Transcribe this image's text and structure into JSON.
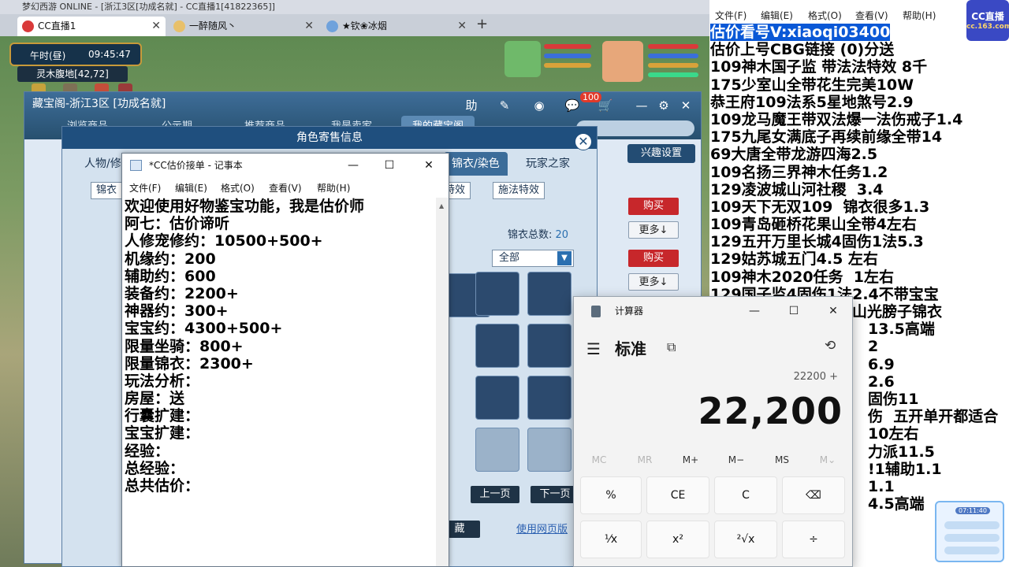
{
  "game_window": {
    "os_title": "梦幻西游 ONLINE - [浙江3区[功成名就] - CC直播1[41822365]]",
    "tabs": [
      {
        "label": "CC直播1",
        "active": true
      },
      {
        "label": "一醉随风丶",
        "active": false
      },
      {
        "label": "★钦❀冰烟",
        "active": false
      }
    ],
    "clock": {
      "period": "午时(昼)",
      "time": "09:45:47"
    },
    "map": "灵木腹地[42,72]"
  },
  "cbg": {
    "title": "藏宝阁-浙江3区 [功成名就]",
    "nav": [
      "浏览商品",
      "公示期",
      "推荐商品",
      "我是卖家",
      "我的藏宝阁"
    ],
    "active_nav": 4,
    "header_buttons": [
      "助",
      "✎",
      "◉",
      "💬",
      "🛒",
      "—",
      "⚙",
      "✕"
    ],
    "badge": "100",
    "interest_button": "兴趣设置",
    "buy_label": "购买",
    "more_label": "更多↓"
  },
  "role_panel": {
    "title": "角色寄售信息",
    "tabs": [
      "人物/修",
      "锦衣/染色",
      "玩家之家"
    ],
    "active_tab": 1,
    "sub_buttons": [
      "锦衣",
      "特效",
      "施法特效"
    ],
    "skin_total_label": "锦衣总数:",
    "skin_total_value": "20",
    "filter_value": "全部",
    "prev_page": "上一页",
    "next_page": "下一页",
    "collect_label": "藏",
    "web_link": "使用网页版"
  },
  "notepad1": {
    "title": "*CC估价接单 - 记事本",
    "menu": [
      "文件(F)",
      "编辑(E)",
      "格式(O)",
      "查看(V)",
      "帮助(H)"
    ],
    "lines": [
      "欢迎使用好物鉴宝功能，我是估价师",
      "阿七：估价谛听",
      "人修宠修约：10500+500+",
      "机缘约：200",
      "辅助约：600",
      "装备约：2200+",
      "神器约：300+",
      "宝宝约：4300+500+",
      "限量坐骑：800+",
      "限量锦衣：2300+",
      "玩法分析：",
      "房屋：送",
      "行囊扩建：",
      "宝宝扩建：",
      "经验：",
      "总经验：",
      "总共估价："
    ]
  },
  "notepad2": {
    "menu": [
      "文件(F)",
      "编辑(E)",
      "格式(O)",
      "查看(V)",
      "帮助(H)"
    ],
    "selected_line": "估价看号V:xiaoqi03400",
    "lines": [
      "估价上号CBG链接 (0)分送",
      "109神木国子监 带法法特效 8千",
      "175少室山全带花生完美10W",
      "恭王府109法系5星地煞号2.9",
      "109龙马魔王带双法爆一法伤戒子1.4",
      "175九尾女满底子再续前缘全带14",
      "69大唐全带龙游四海2.5",
      "109名扬三界神木任务1.2",
      "129凌波城山河社稷  3.4",
      "109天下无双109  锦衣很多1.3",
      "109青岛砸桥花果山全带4左右",
      "129五开万里长城4固伤1法5.3",
      "129姑苏城五门4.5 左右",
      "109神木2020任务  1左右",
      "129国子监4固伤1法2.4不带宝宝",
      "山光膀子锦衣",
      "13.5高端",
      "2",
      "6.9",
      "2.6",
      "固伤11",
      "伤  五开单开都适合",
      "10左右",
      "力派11.5",
      "!1辅助1.1",
      "1.1",
      "4.5高端"
    ],
    "logo": {
      "main": "CC直播",
      "sub": "cc.163.com"
    },
    "widget_time": "07:11:40"
  },
  "calculator": {
    "title": "计算器",
    "mode": "标准",
    "expression": "22200 +",
    "display": "22,200",
    "memory": [
      "MC",
      "MR",
      "M+",
      "M−",
      "MS",
      "M⌄"
    ],
    "keys": [
      "%",
      "CE",
      "C",
      "⌫",
      "¹⁄x",
      "x²",
      "²√x",
      "÷"
    ]
  },
  "colors": {
    "selection": "#0a58d6",
    "buy_red": "#c7272b",
    "panel_blue": "#1f4f7e",
    "cc_purple": "#3a49c4"
  }
}
